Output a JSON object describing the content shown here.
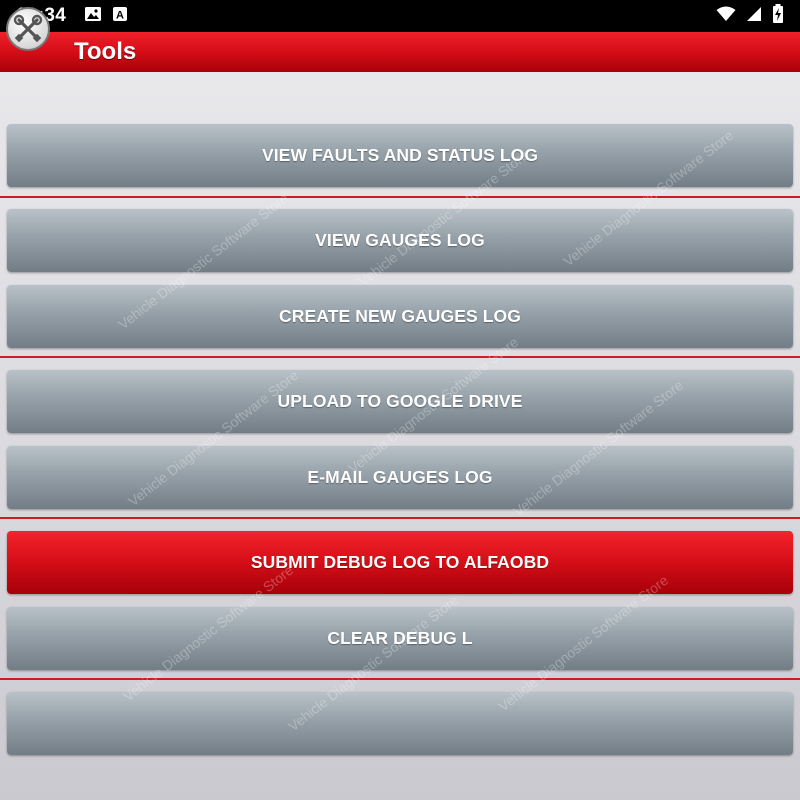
{
  "status_bar": {
    "time": "10:34",
    "icons_left": [
      "image-icon",
      "a-notification-icon"
    ],
    "icons_right": [
      "wifi-icon",
      "signal-icon",
      "battery-charging-icon"
    ]
  },
  "app_bar": {
    "title": "Tools",
    "icon": "tools-wrench-icon",
    "color": "#d10c16"
  },
  "buttons": [
    {
      "label": "VIEW FAULTS AND STATUS LOG",
      "style": "gray"
    },
    {
      "label": "VIEW GAUGES LOG",
      "style": "gray"
    },
    {
      "label": "CREATE NEW GAUGES LOG",
      "style": "gray"
    },
    {
      "label": "UPLOAD TO GOOGLE DRIVE",
      "style": "gray"
    },
    {
      "label": "E-MAIL GAUGES LOG",
      "style": "gray"
    },
    {
      "label": "SUBMIT DEBUG LOG TO ALFAOBD",
      "style": "red"
    },
    {
      "label": "CLEAR DEBUG L",
      "style": "gray"
    },
    {
      "label": "",
      "style": "gray"
    }
  ],
  "watermark": "Vehicle Diagnostic Software Store",
  "colors": {
    "accent_red": "#d10c16",
    "button_gray": "#95a0a8",
    "divider_red": "#cf1a22"
  }
}
